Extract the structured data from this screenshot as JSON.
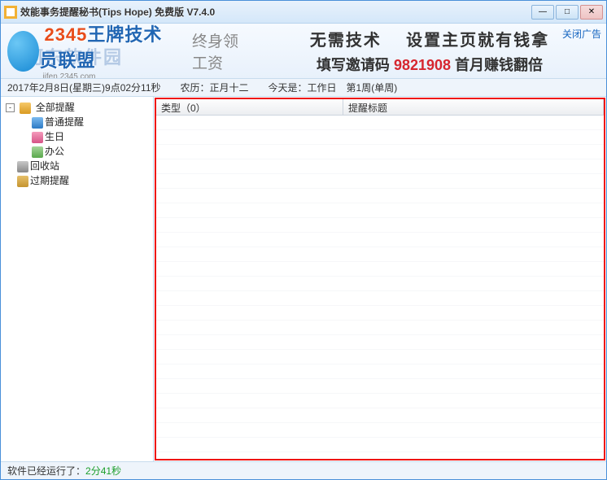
{
  "titlebar": {
    "title": "效能事务提醒秘书(Tips Hope) 免费版 V7.4.0"
  },
  "window_buttons": {
    "min": "—",
    "max": "□",
    "close": "✕"
  },
  "banner": {
    "watermark": "河东软件园",
    "logo_brand": "2345",
    "logo_text": "王牌技术员联盟",
    "logo_sub": "终身领工资",
    "line1_a": "无需技术",
    "line1_b": "设置主页就有钱拿",
    "line2_pre": "填写邀请码",
    "code": "9821908",
    "line2_post": "首月赚钱翻倍",
    "jifen": "jifen.2345.com",
    "close_ad": "关闭广告"
  },
  "datebar": {
    "date": "2017年2月8日(星期三)9点02分11秒",
    "lunar": "农历：正月十二",
    "today": "今天是：工作日　第1周(单周)"
  },
  "tree": {
    "items": [
      {
        "label": "全部提醒",
        "expandable": true,
        "expanded": true
      },
      {
        "label": "普通提醒",
        "child": true
      },
      {
        "label": "生日",
        "child": true
      },
      {
        "label": "办公",
        "child": true
      },
      {
        "label": "回收站"
      },
      {
        "label": "过期提醒"
      }
    ]
  },
  "list": {
    "col_type": "类型（0）",
    "col_title": "提醒标题"
  },
  "status": {
    "prefix": "软件已经运行了：",
    "time": "2分41秒"
  }
}
